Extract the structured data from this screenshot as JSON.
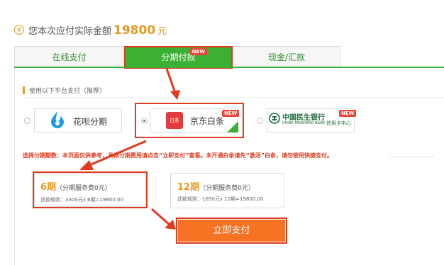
{
  "header": {
    "currency_symbol": "¥",
    "label": "您本次应付实际金额",
    "amount": "19800",
    "unit": "元"
  },
  "tabs": [
    {
      "label": "在线支付"
    },
    {
      "label": "分期付款",
      "badge": "NEW",
      "active": true
    },
    {
      "label": "现金/汇款"
    }
  ],
  "section": {
    "title": "使用以下平台支付（推荐）"
  },
  "platforms": [
    {
      "label": "花呗分期",
      "icon": "huabei-logo-icon",
      "selected": false
    },
    {
      "label": "京东白条",
      "logo_text": "白条",
      "icon": "jd-baitiao-logo-icon",
      "badge": "NEW",
      "selected": true
    },
    {
      "label": "中国民生银行",
      "label_en": "CHINA MINSHENG BANK",
      "sub": "信用卡中心",
      "icon": "cmbc-logo-icon",
      "badge": "NEW",
      "selected": false
    }
  ],
  "notice": "选择分期期数：本页面仅供参考，具体分期费用请点击“立即支付”查看。未开通白条请先“激活”白条，请勿使用快捷支付。",
  "plans": [
    {
      "periods": "6期",
      "fee": "（分期服务费0元）",
      "rule": "还款规则：3300元x 6期=19800.00",
      "selected": true
    },
    {
      "periods": "12期",
      "fee": "（分期服务费0元）",
      "rule": "还款规则：1650元x 12期=19800.00",
      "selected": false
    }
  ],
  "pay_button": {
    "label": "立即支付"
  },
  "colors": {
    "accent_green": "#3cb034",
    "highlight_red": "#e03a1f",
    "amount_orange": "#e39b24",
    "pay_orange": "#f57322"
  }
}
